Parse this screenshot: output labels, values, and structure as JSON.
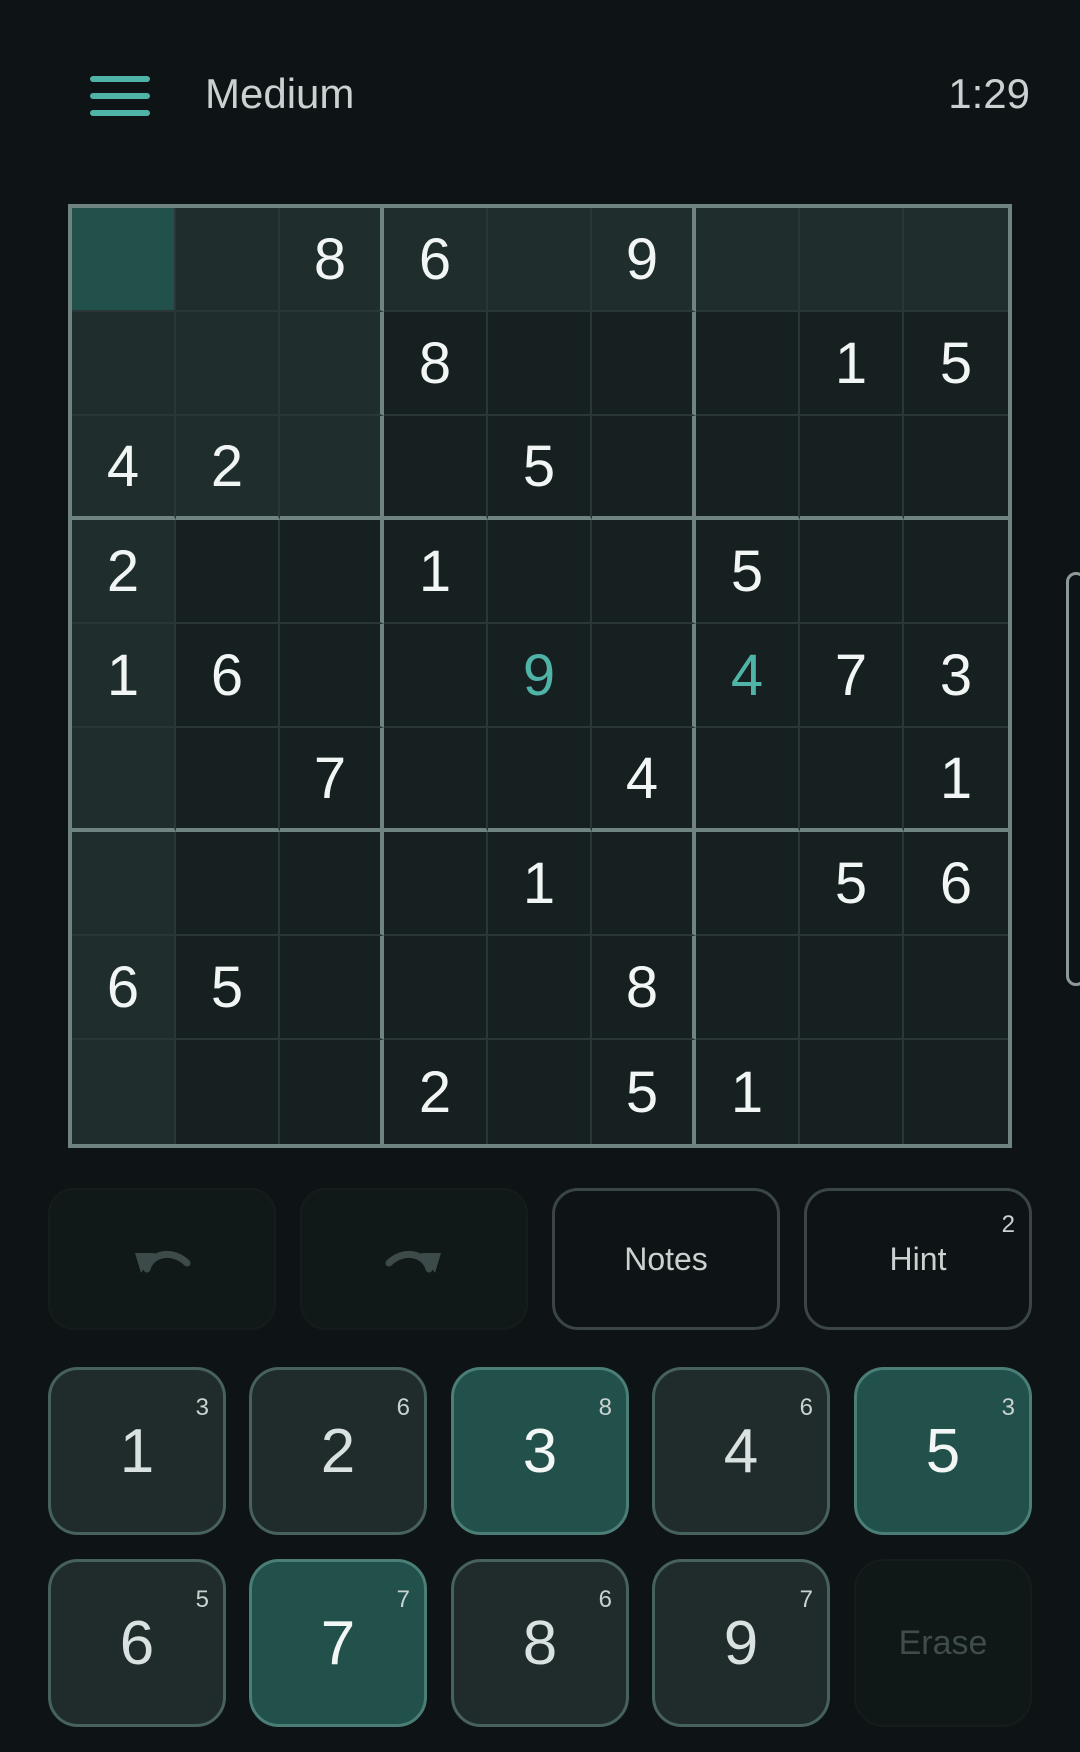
{
  "header": {
    "difficulty": "Medium",
    "timer": "1:29"
  },
  "board": {
    "grid": [
      [
        "",
        "",
        "8",
        "6",
        "",
        "9",
        "",
        "",
        ""
      ],
      [
        "",
        "",
        "",
        "8",
        "",
        "",
        "",
        "1",
        "5"
      ],
      [
        "4",
        "2",
        "",
        "",
        "5",
        "",
        "",
        "",
        ""
      ],
      [
        "2",
        "",
        "",
        "1",
        "",
        "",
        "5",
        "",
        ""
      ],
      [
        "1",
        "6",
        "",
        "",
        "9",
        "",
        "4",
        "7",
        "3"
      ],
      [
        "",
        "",
        "7",
        "",
        "",
        "4",
        "",
        "",
        "1"
      ],
      [
        "",
        "",
        "",
        "",
        "1",
        "",
        "",
        "5",
        "6"
      ],
      [
        "6",
        "5",
        "",
        "",
        "",
        "8",
        "",
        "",
        ""
      ],
      [
        "",
        "",
        "",
        "2",
        "",
        "5",
        "1",
        "",
        ""
      ]
    ],
    "user_entered": [
      [
        4,
        4
      ],
      [
        4,
        6
      ]
    ],
    "selected": [
      0,
      0
    ]
  },
  "tools": {
    "notes_label": "Notes",
    "hint_label": "Hint",
    "hint_count": "2"
  },
  "keypad": {
    "keys": [
      {
        "digit": "1",
        "count": "3",
        "active": false
      },
      {
        "digit": "2",
        "count": "6",
        "active": false
      },
      {
        "digit": "3",
        "count": "8",
        "active": true
      },
      {
        "digit": "4",
        "count": "6",
        "active": false
      },
      {
        "digit": "5",
        "count": "3",
        "active": true
      },
      {
        "digit": "6",
        "count": "5",
        "active": false
      },
      {
        "digit": "7",
        "count": "7",
        "active": true
      },
      {
        "digit": "8",
        "count": "6",
        "active": false
      },
      {
        "digit": "9",
        "count": "7",
        "active": false
      }
    ],
    "erase_label": "Erase"
  },
  "colors": {
    "accent": "#4fb3a7",
    "selected_cell": "#22504a",
    "highlight_cell": "#1f2e2d"
  }
}
